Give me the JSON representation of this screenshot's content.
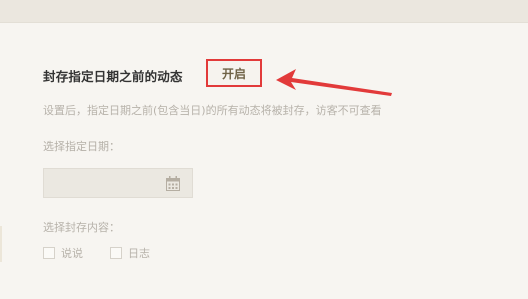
{
  "header": {},
  "archive": {
    "title": "封存指定日期之前的动态",
    "toggle_label": "开启",
    "description": "设置后，指定日期之前(包含当日)的所有动态将被封存，访客不可查看",
    "date_label": "选择指定日期：",
    "date_value": "",
    "content_label": "选择封存内容：",
    "options": [
      {
        "label": "说说",
        "checked": false
      },
      {
        "label": "日志",
        "checked": false
      }
    ]
  },
  "colors": {
    "highlight": "#e23a3a",
    "arrow": "#e23a3a",
    "toggle_text": "#6f6246"
  },
  "icons": {
    "calendar": "calendar-icon",
    "arrow": "arrow-pointer-icon"
  }
}
